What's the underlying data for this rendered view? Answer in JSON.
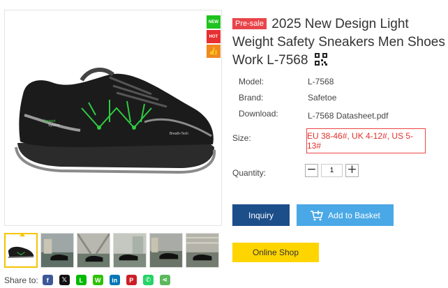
{
  "badges": {
    "new": "NEW",
    "hot": "HOT",
    "like": "👍"
  },
  "title": {
    "presale": "Pre-sale",
    "text": "2025 New Design Light Weight Safety Sneakers Men Shoes Work L-7568"
  },
  "specs": [
    {
      "label": "Model:",
      "value": "L-7568"
    },
    {
      "label": "Brand:",
      "value": "Safetoe"
    },
    {
      "label": "Download:",
      "value": "L-7568 Datasheet.pdf"
    }
  ],
  "size": {
    "label": "Size:",
    "value": "EU 38-46#, UK 4-12#, US 5-13#"
  },
  "quantity": {
    "label": "Quantity:",
    "value": "1",
    "minus": "−",
    "plus": "+"
  },
  "buttons": {
    "inquiry": "Inquiry",
    "basket": "Add to Basket",
    "shop": "Online Shop"
  },
  "shoe_text": {
    "support": "Support",
    "system": "System",
    "brand": "Breath-Tech"
  },
  "share": {
    "label": "Share to:",
    "icons": [
      {
        "name": "facebook-icon",
        "glyph": "f",
        "color": "#3b5998"
      },
      {
        "name": "x-icon",
        "glyph": "𝕏",
        "color": "#111111"
      },
      {
        "name": "line-icon",
        "glyph": "L",
        "color": "#00b900"
      },
      {
        "name": "wechat-icon",
        "glyph": "W",
        "color": "#2dc100"
      },
      {
        "name": "linkedin-icon",
        "glyph": "in",
        "color": "#0077b5"
      },
      {
        "name": "pinterest-icon",
        "glyph": "P",
        "color": "#cb2027"
      },
      {
        "name": "whatsapp-icon",
        "glyph": "✆",
        "color": "#25d366"
      },
      {
        "name": "share-icon",
        "glyph": "⋖",
        "color": "#5cb85c"
      }
    ]
  }
}
